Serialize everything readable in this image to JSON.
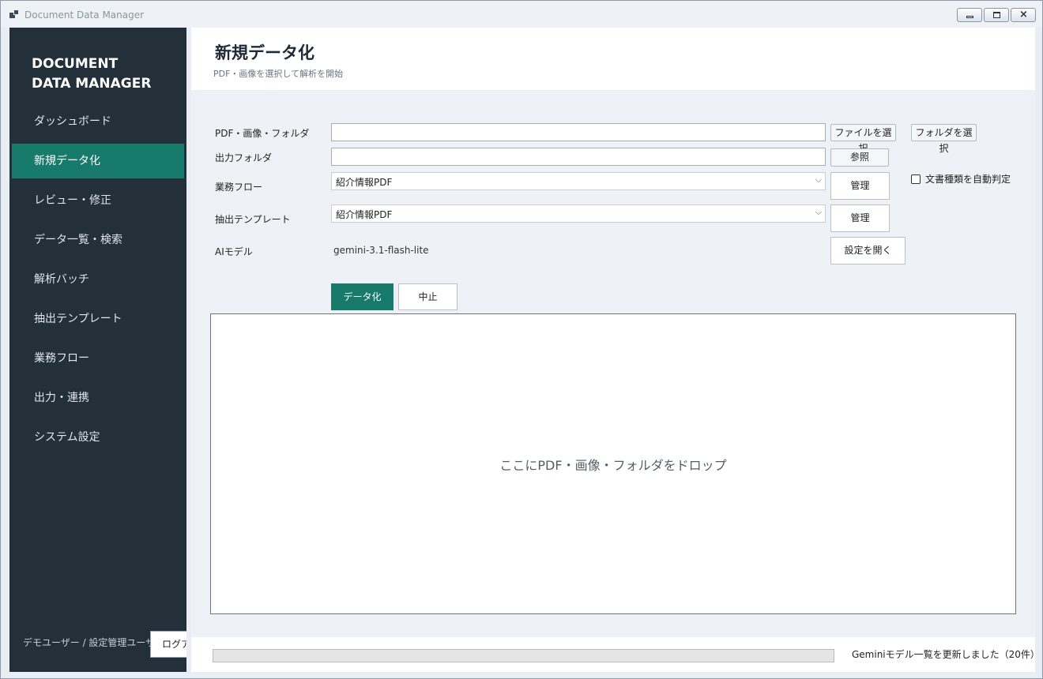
{
  "window": {
    "title": "Document Data Manager"
  },
  "sidebar": {
    "brand_line1": "DOCUMENT",
    "brand_line2": "DATA MANAGER",
    "items": [
      {
        "label": "ダッシュボード",
        "active": false
      },
      {
        "label": "新規データ化",
        "active": true
      },
      {
        "label": "レビュー・修正",
        "active": false
      },
      {
        "label": "データ一覧・検索",
        "active": false
      },
      {
        "label": "解析バッチ",
        "active": false
      },
      {
        "label": "抽出テンプレート",
        "active": false
      },
      {
        "label": "業務フロー",
        "active": false
      },
      {
        "label": "出力・連携",
        "active": false
      },
      {
        "label": "システム設定",
        "active": false
      }
    ],
    "user": "デモユーザー / 設定管理ユーザー",
    "logout_label": "ログアウト"
  },
  "header": {
    "title": "新規データ化",
    "subtitle": "PDF・画像を選択して解析を開始"
  },
  "form": {
    "input_label": "PDF・画像・フォルダ",
    "input_value": "",
    "select_file_button": "ファイルを選択",
    "select_folder_button": "フォルダを選択",
    "output_label": "出力フォルダ",
    "output_value": "",
    "browse_button": "参照",
    "workflow_label": "業務フロー",
    "workflow_value": "紹介情報PDF",
    "workflow_manage_button": "管理",
    "template_label": "抽出テンプレート",
    "template_value": "紹介情報PDF",
    "template_manage_button": "管理",
    "ai_model_label": "AIモデル",
    "ai_model_value": "gemini-3.1-flash-lite",
    "open_settings_button": "設定を開く",
    "auto_detect_label": "文書種類を自動判定",
    "auto_detect_checked": false
  },
  "actions": {
    "run_button": "データ化",
    "stop_button": "中止"
  },
  "dropzone": {
    "text": "ここにPDF・画像・フォルダをドロップ"
  },
  "footer": {
    "progress": 0,
    "status": "Geminiモデル一覧を更新しました（20件）"
  },
  "colors": {
    "accent": "#177a6b",
    "sidebar_bg": "#232f39"
  }
}
